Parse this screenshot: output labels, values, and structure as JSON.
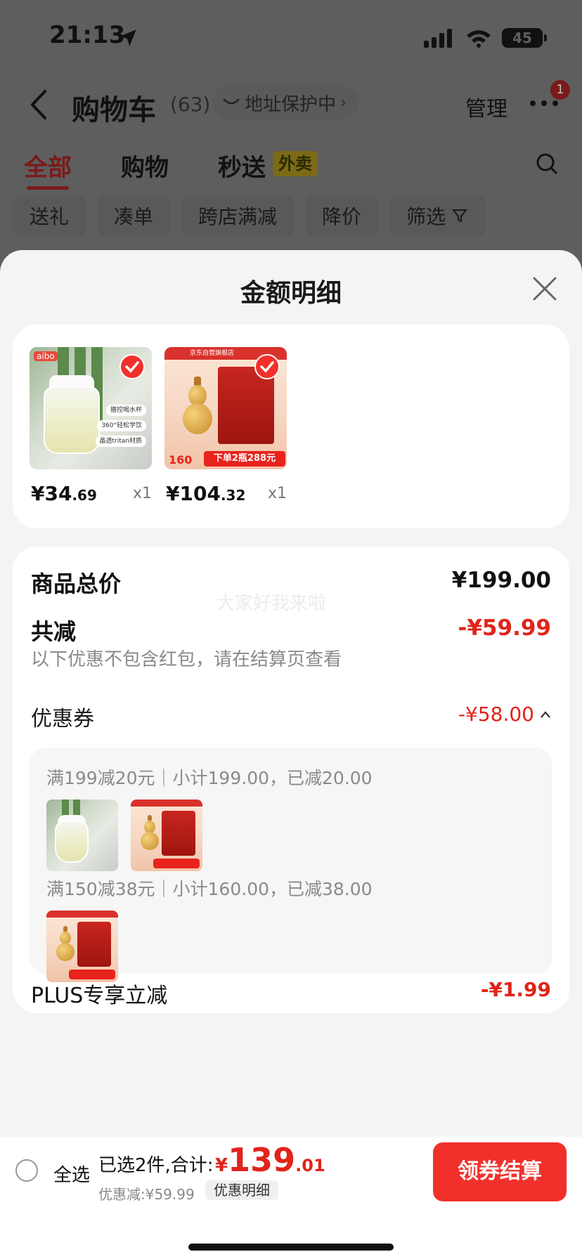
{
  "status_bar": {
    "time": "21:13",
    "battery": "45"
  },
  "header": {
    "title": "购物车",
    "count": "(63)",
    "address_protect": "地址保护中",
    "manage": "管理",
    "badge": "1"
  },
  "tabs": [
    {
      "label": "全部",
      "active": true
    },
    {
      "label": "购物"
    },
    {
      "label": "秒送"
    }
  ],
  "takeout_tag": "外卖",
  "filters": [
    "送礼",
    "凑单",
    "跨店满减",
    "降价",
    "筛选"
  ],
  "sheet": {
    "title": "金额明细",
    "products": [
      {
        "price_int": "¥34",
        "price_dec": ".69",
        "qty": "x1"
      },
      {
        "price_int": "¥104",
        "price_dec": ".32",
        "qty": "x1"
      }
    ],
    "product_bottle_texts": {
      "logo": "aibo",
      "l1": "膳控喝水杯",
      "l2": "360°轻松学饮",
      "l3": "晶透tritan材质"
    },
    "product_wine_texts": {
      "topbar": "京东自营旗舰店",
      "promo": "下单2瓶288元",
      "price": "160"
    },
    "goods_total_label": "商品总价",
    "goods_total": "¥199.00",
    "watermark": "大家好我来啦",
    "discount_label": "共减",
    "discount_total": "-¥59.99",
    "discount_note": "以下优惠不包含红包，请在结算页查看",
    "coupon_label": "优惠券",
    "coupon_total": "-¥58.00",
    "coupon_rule_1": "满199减20元｜小计199.00，已减20.00",
    "coupon_rule_2": "满150减38元｜小计160.00，已减38.00",
    "plus_label": "PLUS专享立减",
    "plus_amount": "-¥1.99"
  },
  "bottom_bar": {
    "select_all": "全选",
    "selected": "已选2件,合计:",
    "currency": "¥",
    "total_int": "139",
    "total_dec": ".01",
    "saved": "优惠减:¥59.99",
    "detail": "优惠明细",
    "checkout": "领券结算"
  },
  "colors": {
    "accent": "#e0241b",
    "checkout": "#f2302b"
  }
}
